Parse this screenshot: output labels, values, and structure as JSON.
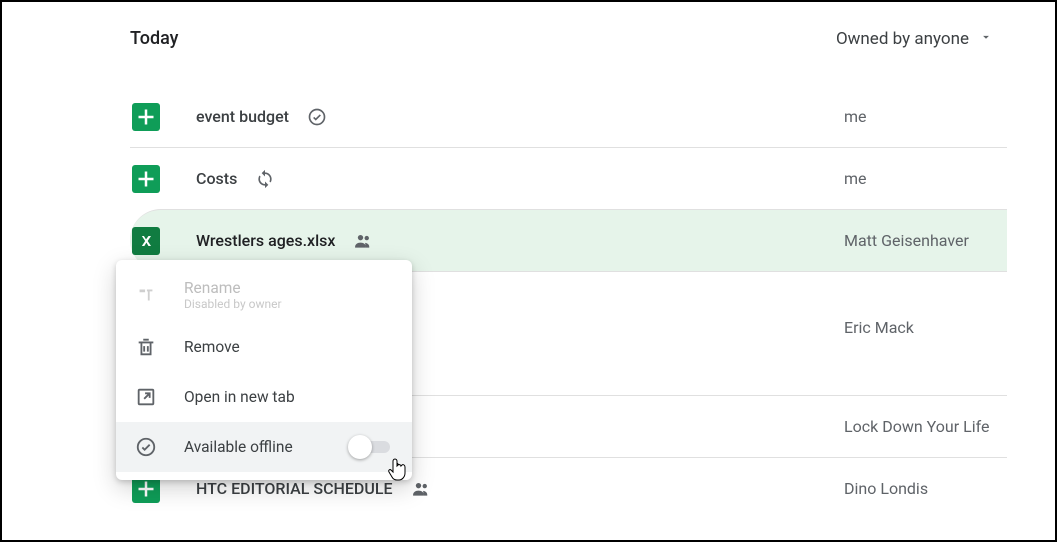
{
  "header": {
    "section_title": "Today",
    "owner_filter_label": "Owned by anyone"
  },
  "files": [
    {
      "name": "event budget",
      "owner": "me",
      "icon": "sheets",
      "badge": "offline"
    },
    {
      "name": "Costs",
      "owner": "me",
      "icon": "sheets",
      "badge": "sync"
    },
    {
      "name": "Wrestlers ages.xlsx",
      "owner": "Matt Geisenhaver",
      "icon": "xlsx",
      "badge": "shared"
    },
    {
      "name": "",
      "owner": "Eric Mack",
      "icon": "",
      "badge": ""
    },
    {
      "name": "",
      "owner": "Lock Down Your Life",
      "icon": "",
      "badge": ""
    },
    {
      "name": "HTC EDITORIAL SCHEDULE",
      "owner": "Dino Londis",
      "icon": "sheets",
      "badge": "shared"
    }
  ],
  "context_menu": {
    "rename": {
      "label": "Rename",
      "sub": "Disabled by owner"
    },
    "remove": {
      "label": "Remove"
    },
    "open_new_tab": {
      "label": "Open in new tab"
    },
    "available_offline": {
      "label": "Available offline",
      "toggle": false
    }
  }
}
